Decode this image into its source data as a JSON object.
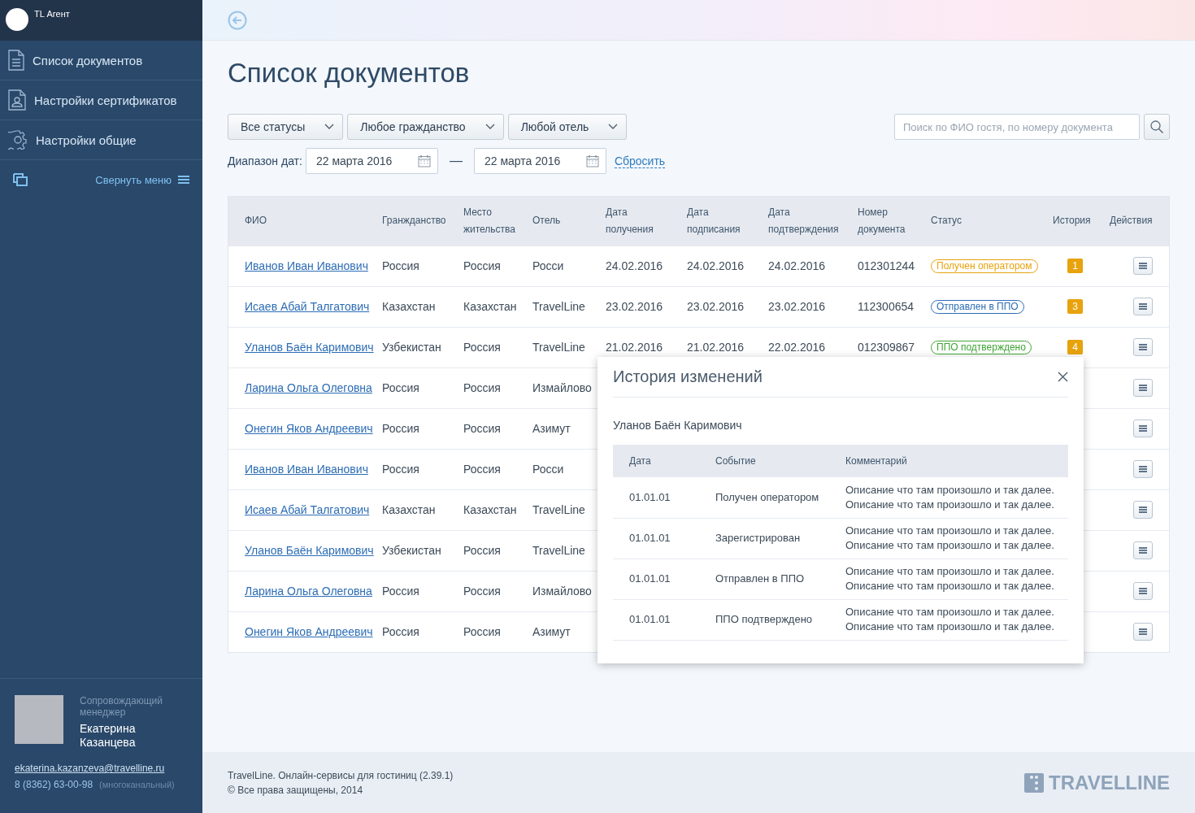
{
  "sidebar": {
    "app_title": "TL Агент",
    "items": [
      {
        "kind": "document",
        "label": "Список документов"
      },
      {
        "kind": "certificate",
        "label": "Настройки  сертификатов"
      },
      {
        "kind": "settings",
        "label": "Настройки общие"
      }
    ],
    "collapse_label": "Свернуть меню",
    "manager": {
      "role": "Сопровождающий менеджер",
      "name": "Екатерина Казанцева",
      "email": "ekaterina.kazanzeva@travelline.ru",
      "phone": "8 (8362) 63-00-98",
      "phone_note": "(многоканальный)"
    }
  },
  "page_title": "Список документов",
  "filters": {
    "dropdowns": [
      "Все статусы",
      "Любое гражданство",
      "Любой отель"
    ],
    "date_label": "Диапазон дат:",
    "date_from": "22 марта 2016",
    "date_separator": "—",
    "date_to": "22 марта 2016",
    "reset": "Сбросить",
    "search_placeholder": "Поиск по ФИО гостя, по номеру документа"
  },
  "table": {
    "columns": [
      "ФИО",
      "Гранжданство",
      "Место жительства",
      "Отель",
      "Дата получения",
      "Дата подписания",
      "Дата подтверждения",
      "Номер документа",
      "Статус",
      "История",
      "Действия"
    ],
    "rows": [
      {
        "name": "Иванов Иван Иванович",
        "citizenship": "Россия",
        "residence": "Россия",
        "hotel": "Росси",
        "received": "24.02.2016",
        "signed": "24.02.2016",
        "confirmed": "24.02.2016",
        "doc_number": "012301244",
        "status": {
          "label": "Получен оператором",
          "color": "#e8a20c"
        },
        "history": "1"
      },
      {
        "name": "Исаев Абай Талгатович",
        "citizenship": "Казахстан",
        "residence": "Казахстан",
        "hotel": "TravelLine",
        "received": "23.02.2016",
        "signed": "23.02.2016",
        "confirmed": "23.02.2016",
        "doc_number": "112300654",
        "status": {
          "label": "Отправлен в ППО",
          "color": "#2d6db5"
        },
        "history": "3"
      },
      {
        "name": "Уланов Баён Каримович",
        "citizenship": "Узбекистан",
        "residence": "Россия",
        "hotel": "TravelLine",
        "received": "21.02.2016",
        "signed": "21.02.2016",
        "confirmed": "22.02.2016",
        "doc_number": "012309867",
        "status": {
          "label": "ППО подтверждено",
          "color": "#3fa535"
        },
        "history": "4"
      },
      {
        "name": "Ларина Ольга Олеговна",
        "citizenship": "Россия",
        "residence": "Россия",
        "hotel": "Измайлово"
      },
      {
        "name": "Онегин Яков Андреевич ",
        "citizenship": "Россия",
        "residence": "Россия",
        "hotel": "Азимут"
      },
      {
        "name": "Иванов Иван Иванович",
        "citizenship": "Россия",
        "residence": "Россия",
        "hotel": "Росси"
      },
      {
        "name": "Исаев Абай Талгатович",
        "citizenship": "Казахстан",
        "residence": "Казахстан",
        "hotel": "TravelLine"
      },
      {
        "name": "Уланов Баён Каримович",
        "citizenship": "Узбекистан",
        "residence": "Россия",
        "hotel": "TravelLine"
      },
      {
        "name": "Ларина Ольга Олеговна",
        "citizenship": "Россия",
        "residence": "Россия",
        "hotel": "Измайлово"
      },
      {
        "name": "Онегин Яков Андреевич ",
        "citizenship": "Россия",
        "residence": "Россия",
        "hotel": "Азимут"
      }
    ]
  },
  "history_popup": {
    "title": "История изменений",
    "guest": "Уланов Баён Каримович",
    "columns": [
      "Дата",
      "Событие",
      "Комментарий"
    ],
    "rows": [
      {
        "date": "01.01.01",
        "event": "Получен оператором",
        "comment": "Описание что там произошло и так далее. Описание что там произошло и так далее."
      },
      {
        "date": "01.01.01",
        "event": "Зарегистрирован",
        "comment": "Описание что там произошло и так далее. Описание что там произошло и так далее."
      },
      {
        "date": "01.01.01",
        "event": "Отправлен в ППО",
        "comment": "Описание что там произошло и так далее. Описание что там произошло и так далее."
      },
      {
        "date": "01.01.01",
        "event": "ППО подтверждено",
        "comment": "Описание что там произошло и так далее. Описание что там произошло и так далее."
      }
    ]
  },
  "footer": {
    "line_1": "TravelLine. Онлайн-сервисы для гостиниц (2.39.1)",
    "line_2": "© Все права защищены, 2014",
    "logo": "TRAVELLINE"
  }
}
